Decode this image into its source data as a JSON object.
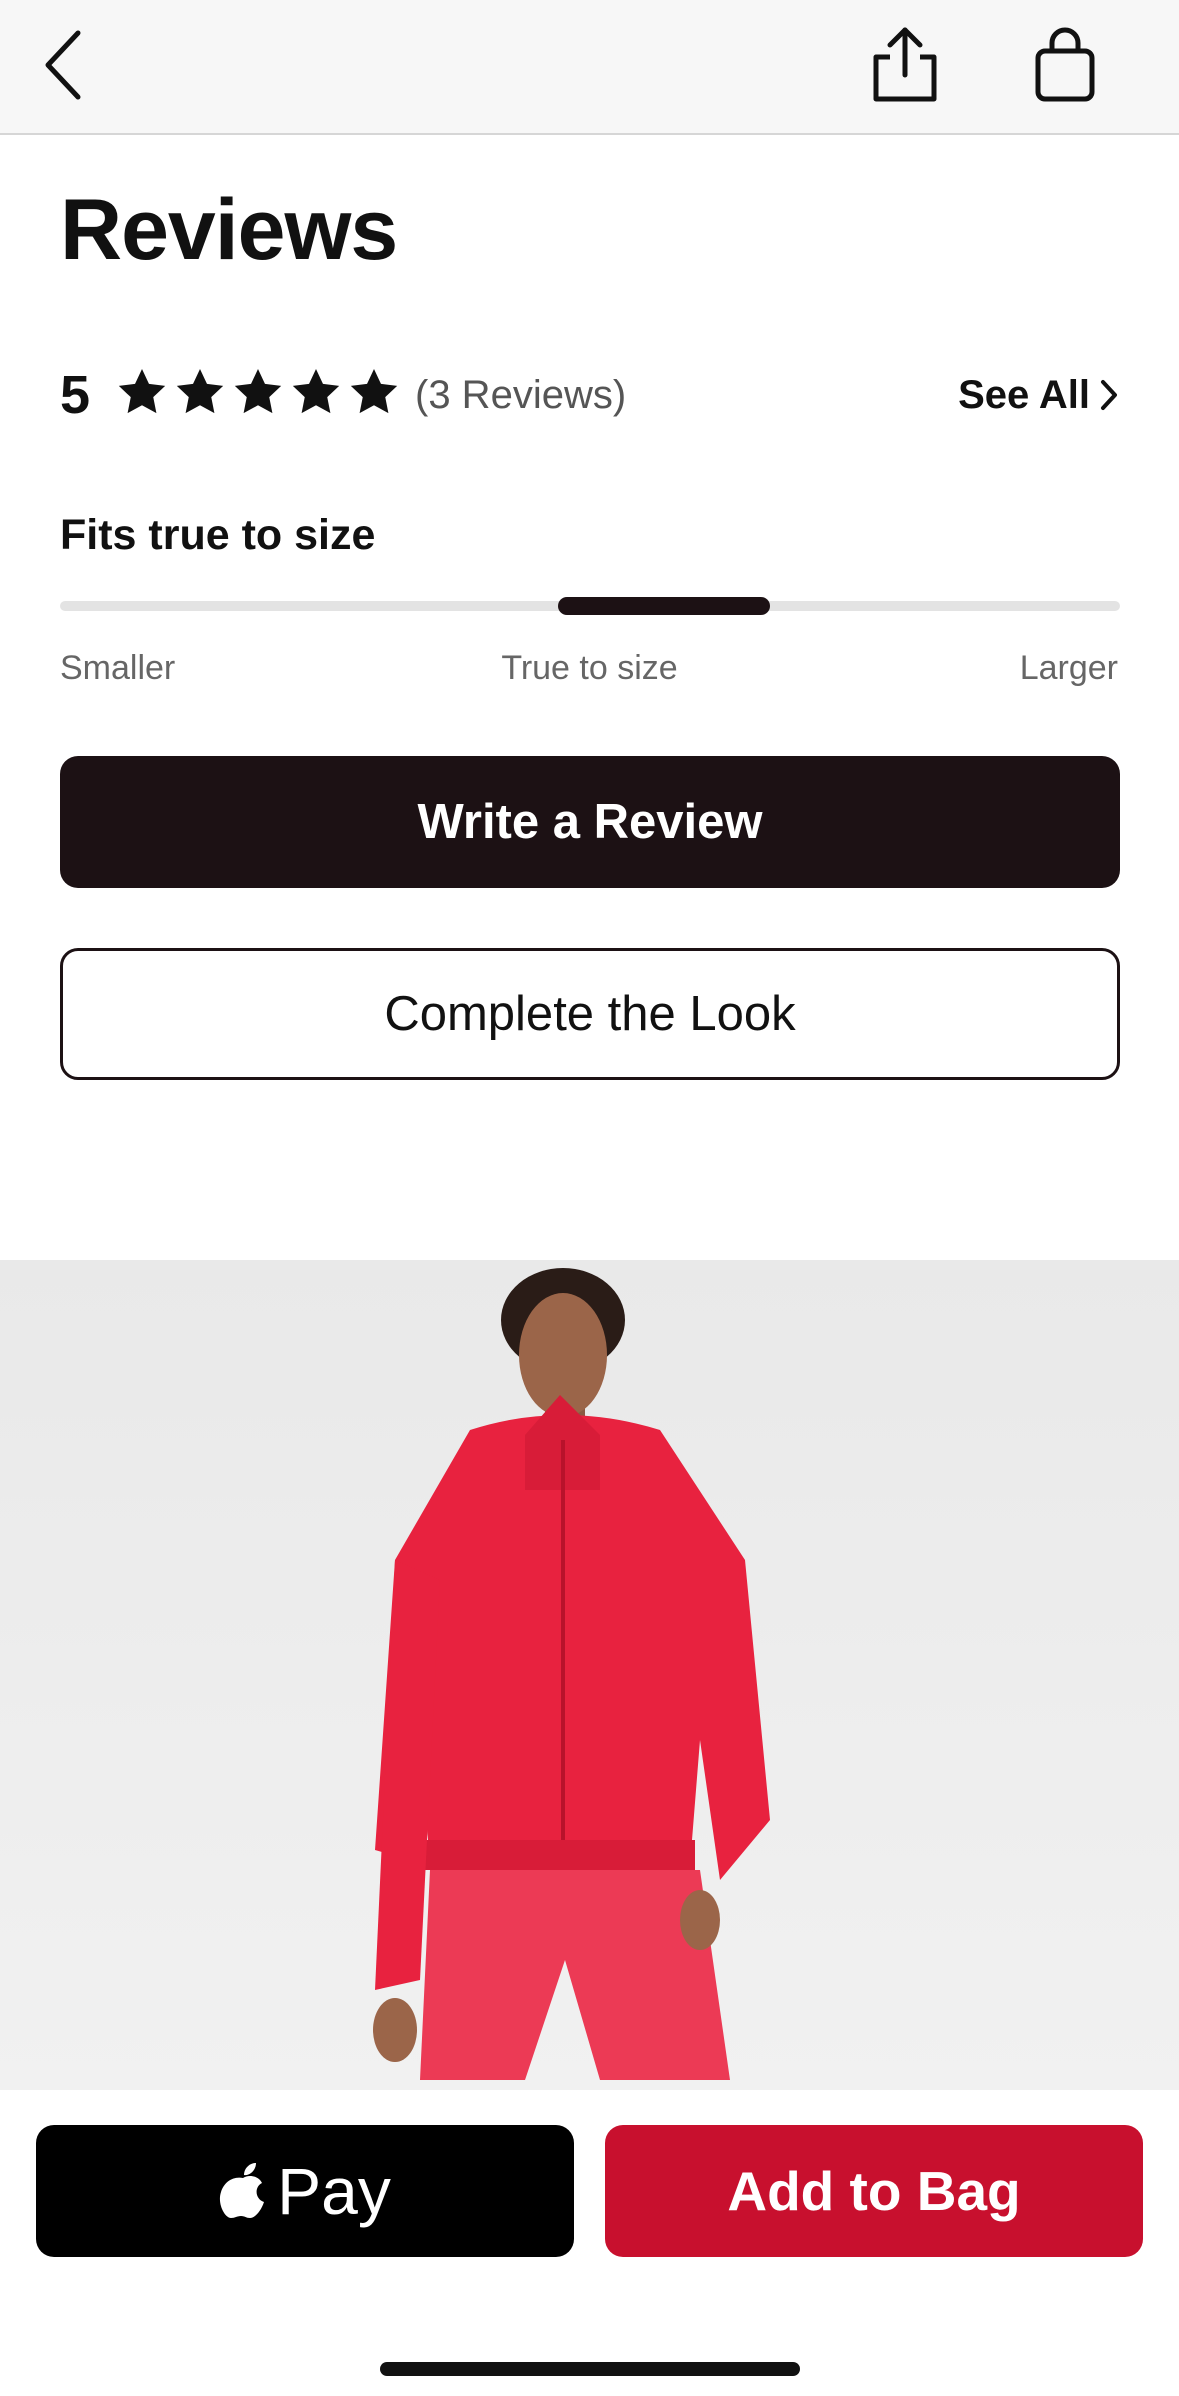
{
  "header": {
    "back_icon": "chevron-left-icon",
    "share_icon": "share-icon",
    "bag_icon": "shopping-bag-icon"
  },
  "reviews": {
    "title": "Reviews",
    "rating": "5",
    "stars_filled": 5,
    "stars_total": 5,
    "review_count_text": "(3 Reviews)",
    "see_all_label": "See All"
  },
  "fit": {
    "label": "Fits true to size",
    "scale_min": "Smaller",
    "scale_mid": "True to size",
    "scale_max": "Larger",
    "indicator_position": 0.57
  },
  "actions": {
    "write_review": "Write a Review",
    "complete_look": "Complete the Look"
  },
  "checkout": {
    "apple_pay_label": "Pay",
    "add_to_bag_label": "Add to Bag"
  },
  "colors": {
    "accent_red": "#c8102e",
    "primary_dark": "#1c1114",
    "header_bg": "#f7f7f7",
    "jacket_red": "#e8223f"
  }
}
